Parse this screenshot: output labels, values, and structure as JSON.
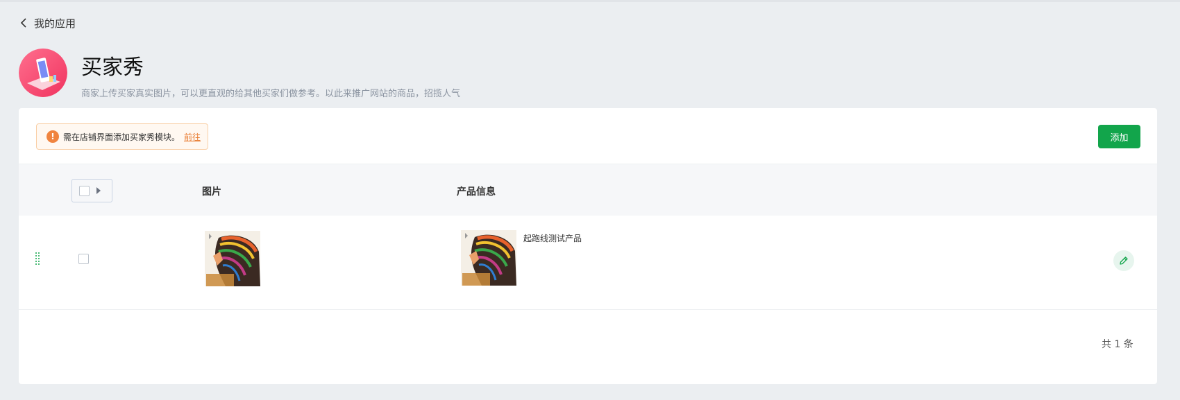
{
  "nav": {
    "back_label": "我的应用"
  },
  "app": {
    "title": "买家秀",
    "description": "商家上传买家真实图片，可以更直观的给其他买家们做参考。以此来推广网站的商品，招揽人气"
  },
  "notice": {
    "text": "需在店铺界面添加买家秀模块。",
    "link_label": "前往"
  },
  "toolbar": {
    "add_label": "添加"
  },
  "table": {
    "columns": {
      "image": "图片",
      "product_info": "产品信息"
    },
    "rows": [
      {
        "product_name": "起跑线测试产品"
      }
    ]
  },
  "pagination": {
    "total_label": "共 1 条"
  },
  "colors": {
    "primary": "#12a54b",
    "warning": "#f0843f",
    "background": "#ebeef1"
  }
}
